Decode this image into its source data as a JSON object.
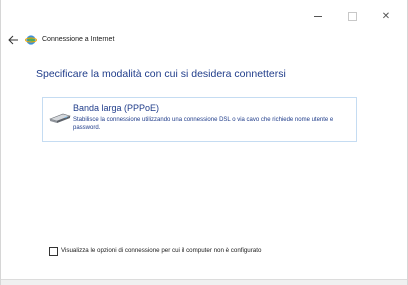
{
  "window": {
    "minimize_glyph": "",
    "maximize_glyph": "",
    "close_glyph": "✕"
  },
  "header": {
    "back_icon": "back-arrow-icon",
    "app_icon": "network-globe-icon",
    "title": "Connessione a Internet"
  },
  "main": {
    "heading": "Specificare la modalità con cui si desidera connettersi",
    "options": [
      {
        "icon": "broadband-modem-icon",
        "title": "Banda larga (PPPoE)",
        "description": "Stabilisce la connessione utilizzando una connessione DSL o via cavo che richiede nome utente e password."
      }
    ],
    "checkbox": {
      "checked": false,
      "label": "Visualizza le opzioni di connessione per cui il computer non è configurato"
    }
  },
  "colors": {
    "heading": "#1f3c8a",
    "card_border": "#c5dcf2",
    "background": "#ffffff"
  }
}
